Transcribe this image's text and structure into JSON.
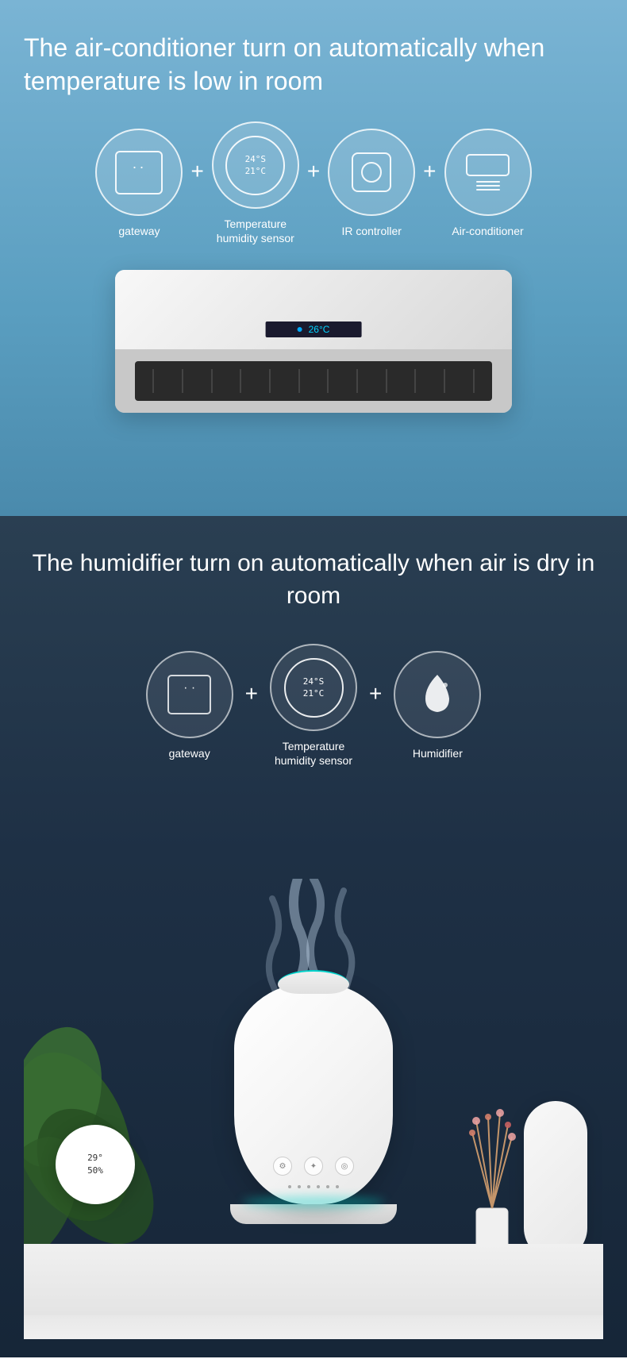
{
  "section1": {
    "title": "The air-conditioner turn on automatically when temperature is low in room",
    "icons": [
      {
        "label": "gateway",
        "type": "gateway"
      },
      {
        "label": "Temperature\nhumidity sensor",
        "type": "temp-sensor"
      },
      {
        "label": "IR controller",
        "type": "ir-controller"
      },
      {
        "label": "Air-conditioner",
        "type": "ac"
      }
    ],
    "ac_display": "26°C",
    "plus": "+"
  },
  "section2": {
    "title": "The humidifier turn on automatically\nwhen air is dry in room",
    "icons": [
      {
        "label": "gateway",
        "type": "gateway"
      },
      {
        "label": "Temperature\nhumidity sensor",
        "type": "temp-sensor"
      },
      {
        "label": "Humidifier",
        "type": "humidifier"
      }
    ],
    "plus": "+",
    "temp_reading1": "29°",
    "temp_reading2": "50%"
  }
}
